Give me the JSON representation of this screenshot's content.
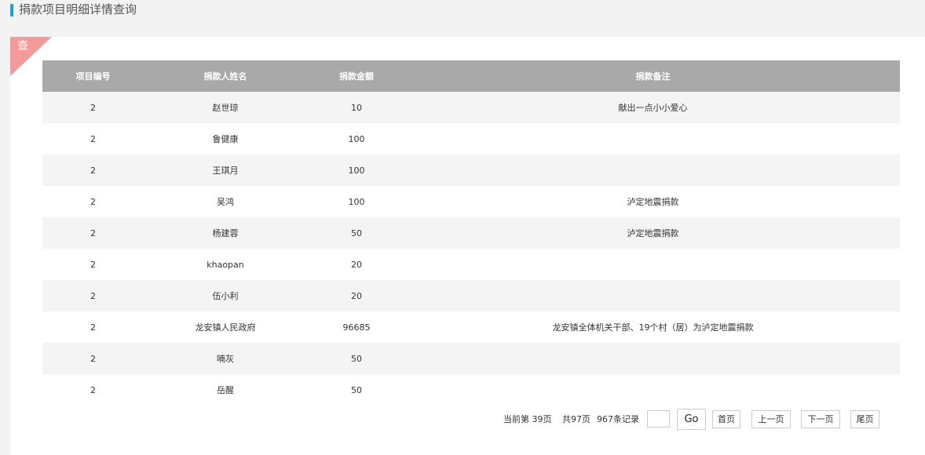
{
  "header": {
    "title": "捐款项目明细详情查询"
  },
  "panel": {
    "corner_label": "查"
  },
  "table": {
    "columns": [
      "项目编号",
      "捐款人姓名",
      "捐款金额",
      "捐款备注"
    ],
    "rows": [
      [
        "2",
        "赵世琼",
        "10",
        "献出一点小小爱心"
      ],
      [
        "2",
        "鲁健康",
        "100",
        ""
      ],
      [
        "2",
        "王琪月",
        "100",
        ""
      ],
      [
        "2",
        "吴鸿",
        "100",
        "泸定地震捐款"
      ],
      [
        "2",
        "杨建蓉",
        "50",
        "泸定地震捐款"
      ],
      [
        "2",
        "khaopan",
        "20",
        ""
      ],
      [
        "2",
        "伍小利",
        "20",
        ""
      ],
      [
        "2",
        "龙安镇人民政府",
        "96685",
        "龙安镇全体机关干部、19个村（居）为泸定地震捐款"
      ],
      [
        "2",
        "喃灰",
        "50",
        ""
      ],
      [
        "2",
        "岳醒",
        "50",
        ""
      ]
    ]
  },
  "pager": {
    "current_label": "当前第  39页",
    "total_pages_label": "共97页",
    "total_records_label": "967条记录",
    "page_input_value": "",
    "go_label": "Go",
    "first_label": "首页",
    "prev_label": "上一页",
    "next_label": "下一页",
    "last_label": "尾页"
  }
}
